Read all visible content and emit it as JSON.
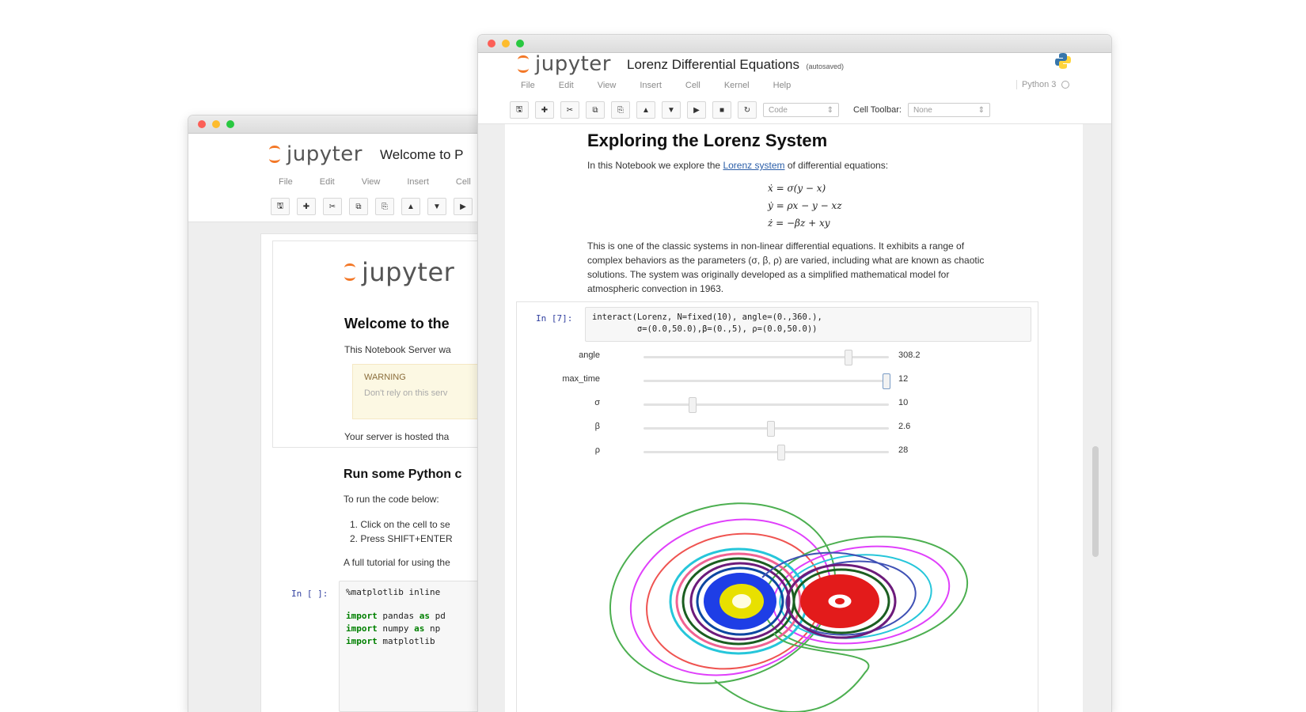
{
  "back_window": {
    "logo_text": "jupyter",
    "notebook_title": "Welcome to P",
    "menu": [
      "File",
      "Edit",
      "View",
      "Insert",
      "Cell"
    ],
    "body": {
      "logo_text": "jupyter",
      "welcome_heading": "Welcome to the",
      "intro_text": "This Notebook Server wa",
      "warning_title": "WARNING",
      "warning_text": "Don't rely on this serv",
      "hosted_text": "Your server is hosted tha",
      "run_heading": "Run some Python c",
      "run_text": "To run the code below:",
      "steps": [
        "1.  Click on the cell to se",
        "2.  Press SHIFT+ENTER"
      ],
      "tutorial_text": "A full tutorial for using the",
      "code_prompt": "In [ ]:",
      "code_line1": "%matplotlib inline",
      "import_lines": [
        {
          "kw": "import",
          "mod": "pandas",
          "as": "as",
          "alias": "pd"
        },
        {
          "kw": "import",
          "mod": "numpy",
          "as": "as",
          "alias": "np"
        },
        {
          "kw": "import",
          "mod": "matplotlib",
          "as": "",
          "alias": ""
        }
      ]
    }
  },
  "front_window": {
    "logo_text": "jupyter",
    "notebook_title": "Lorenz Differential Equations",
    "autosave": "(autosaved)",
    "menu": [
      "File",
      "Edit",
      "View",
      "Insert",
      "Cell",
      "Kernel",
      "Help"
    ],
    "kernel": "Python 3",
    "toolbar": {
      "cell_type": "Code",
      "cell_toolbar_label": "Cell Toolbar:",
      "cell_toolbar_value": "None"
    },
    "notebook": {
      "heading": "Exploring the Lorenz System",
      "intro_before": "In this Notebook we explore the",
      "intro_link": "Lorenz system",
      "intro_after": "of differential equations:",
      "equations": [
        "ẋ = σ(y − x)",
        "ẏ = ρx − y − xz",
        "ż = −βz + xy"
      ],
      "paragraph": [
        "This is one of the classic systems in non-linear differential equations. It exhibits a range of",
        "complex behaviors as the parameters (σ, β, ρ) are varied, including what are known as chaotic",
        "solutions. The system was originally developed as a simplified mathematical model for",
        "atmospheric convection in 1963."
      ],
      "code_prompt": "In [7]:",
      "code_lines": [
        "interact(Lorenz, N=fixed(10), angle=(0.,360.),",
        "         σ=(0.0,50.0),β=(0.,5), ρ=(0.0,50.0))"
      ],
      "sliders": [
        {
          "label": "angle",
          "value": "308.2",
          "fraction": 0.835
        },
        {
          "label": "max_time",
          "value": "12",
          "fraction": 0.99
        },
        {
          "label": "σ",
          "value": "10",
          "fraction": 0.2
        },
        {
          "label": "β",
          "value": "2.6",
          "fraction": 0.52
        },
        {
          "label": "ρ",
          "value": "28",
          "fraction": 0.56
        }
      ]
    }
  },
  "colors": {
    "jupyter_orange": "#f37726",
    "link_blue": "#2b5ea8",
    "prompt_blue": "#303f9f",
    "warning_bg": "#fcf8e3"
  }
}
